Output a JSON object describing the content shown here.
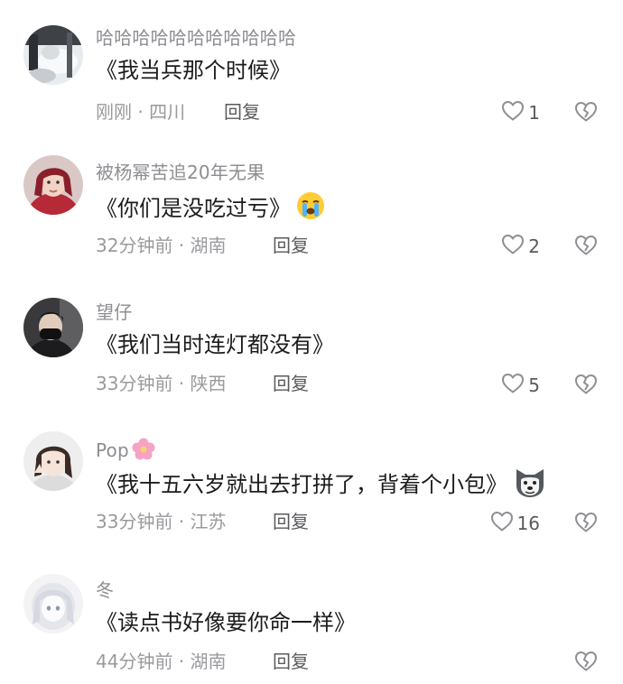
{
  "comments": [
    {
      "username": "哈哈哈哈哈哈哈哈哈哈哈",
      "text": "《我当兵那个时候》",
      "meta": "刚刚 · 四川",
      "reply_label": "回复",
      "likes": "1"
    },
    {
      "username": "被杨幂苦追20年无果",
      "text": "《你们是没吃过亏》",
      "emoji": "crying-face",
      "meta": "32分钟前 · 湖南",
      "reply_label": "回复",
      "likes": "2"
    },
    {
      "username": "望仔",
      "text": "《我们当时连灯都没有》",
      "meta": "33分钟前 · 陕西",
      "reply_label": "回复",
      "likes": "5"
    },
    {
      "username": "Pop",
      "username_emoji": "pink-flower",
      "text": "《我十五六岁就出去打拼了，背着个小包》",
      "emoji": "dog-face",
      "meta": "33分钟前 · 江苏",
      "reply_label": "回复",
      "likes": "16"
    },
    {
      "username": "冬",
      "text": "《读点书好像要你命一样》",
      "meta": "44分钟前 · 湖南",
      "reply_label": "回复",
      "likes": ""
    }
  ],
  "colors": {
    "username": "#8d8d92",
    "text": "#1c1c1e",
    "meta": "#9a9a9e",
    "action": "#5a5a5e"
  }
}
